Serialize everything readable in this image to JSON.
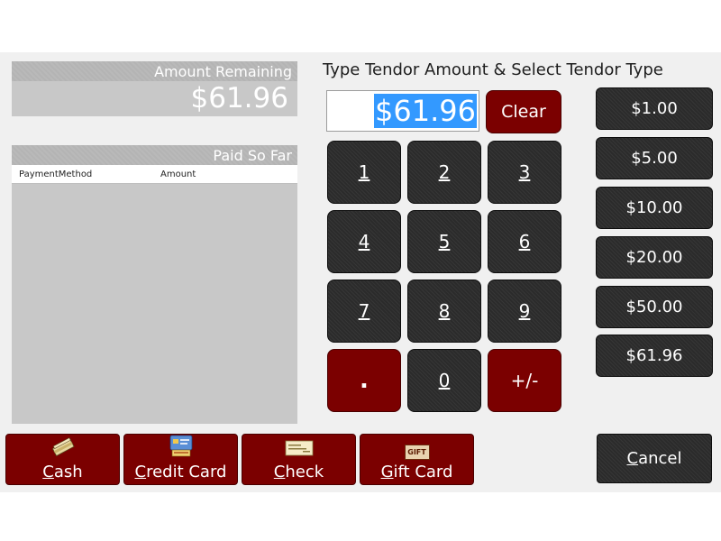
{
  "amount_remaining": {
    "label": "Amount Remaining",
    "value": "$61.96"
  },
  "paid_so_far": {
    "label": "Paid So Far",
    "columns": [
      "PaymentMethod",
      "Amount"
    ]
  },
  "title": "Type Tendor Amount & Select Tendor Type",
  "amount_input": {
    "value": "$61.96"
  },
  "clear_label": "Clear",
  "keypad": [
    "1",
    "2",
    "3",
    "4",
    "5",
    "6",
    "7",
    "8",
    "9",
    ".",
    "0",
    "+/-"
  ],
  "quick_amounts": [
    "$1.00",
    "$5.00",
    "$10.00",
    "$20.00",
    "$50.00",
    "$61.96"
  ],
  "payment_buttons": {
    "cash": {
      "first": "C",
      "rest": "ash"
    },
    "credit": {
      "first": "C",
      "rest": "redit Card"
    },
    "check": {
      "first": "C",
      "rest": "heck"
    },
    "gift": {
      "first": "G",
      "rest": "ift Card",
      "icon_text": "GIFT"
    }
  },
  "cancel": {
    "first": "C",
    "rest": "ancel"
  },
  "icons": {
    "cash": "cash-icon",
    "credit": "credit-card-icon",
    "check": "check-icon",
    "gift": "gift-card-icon"
  },
  "colors": {
    "red": "#7b0000",
    "dark": "#2b2b2b",
    "selection": "#3399ff",
    "panel": "#c8c8c8"
  }
}
